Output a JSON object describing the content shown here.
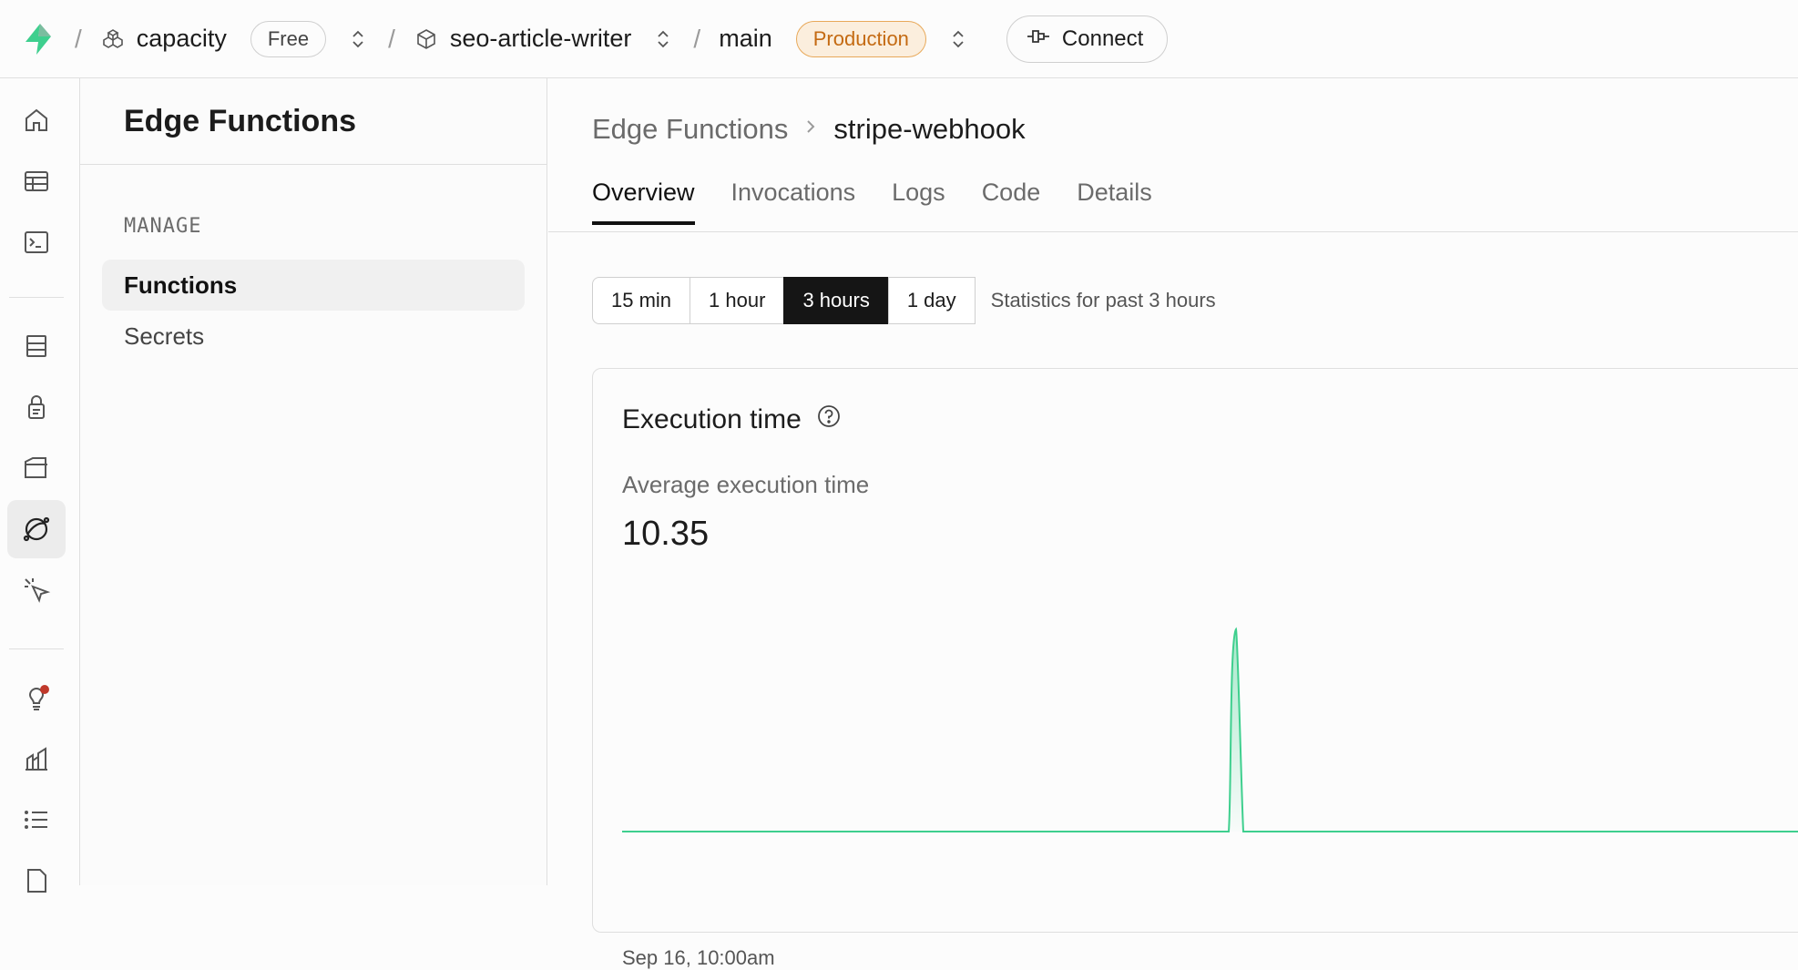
{
  "topbar": {
    "org": "capacity",
    "plan": "Free",
    "project": "seo-article-writer",
    "branch": "main",
    "env": "Production",
    "connect": "Connect"
  },
  "sidebar": {
    "title": "Edge Functions",
    "section": "MANAGE",
    "items": [
      {
        "label": "Functions"
      },
      {
        "label": "Secrets"
      }
    ]
  },
  "main": {
    "breadcrumb_parent": "Edge Functions",
    "breadcrumb_current": "stripe-webhook",
    "tabs": [
      {
        "label": "Overview"
      },
      {
        "label": "Invocations"
      },
      {
        "label": "Logs"
      },
      {
        "label": "Code"
      },
      {
        "label": "Details"
      }
    ],
    "ranges": [
      {
        "label": "15 min"
      },
      {
        "label": "1 hour"
      },
      {
        "label": "3 hours"
      },
      {
        "label": "1 day"
      }
    ],
    "range_status": "Statistics for past 3 hours",
    "card": {
      "title": "Execution time",
      "subtitle": "Average execution time",
      "value": "10.35"
    }
  },
  "chart_data": {
    "type": "area",
    "title": "Execution time",
    "xlabel": "",
    "ylabel": "",
    "x_first_tick": "Sep 16, 10:00am",
    "series": [
      {
        "values": [
          0,
          0,
          0,
          0,
          0,
          0,
          0,
          0,
          0,
          0,
          0,
          0,
          0,
          0,
          0,
          0,
          0,
          0,
          0,
          0,
          10.35,
          0,
          0,
          0,
          0,
          0,
          0,
          0,
          0,
          0,
          0,
          0,
          0,
          0,
          0,
          0,
          0,
          0,
          0,
          0,
          0,
          0,
          0,
          0,
          0,
          0,
          0,
          0,
          0,
          0,
          0,
          0,
          0,
          0,
          0,
          0,
          0,
          0,
          0,
          0
        ]
      }
    ],
    "color": "#3ecf8e",
    "grid": false
  }
}
